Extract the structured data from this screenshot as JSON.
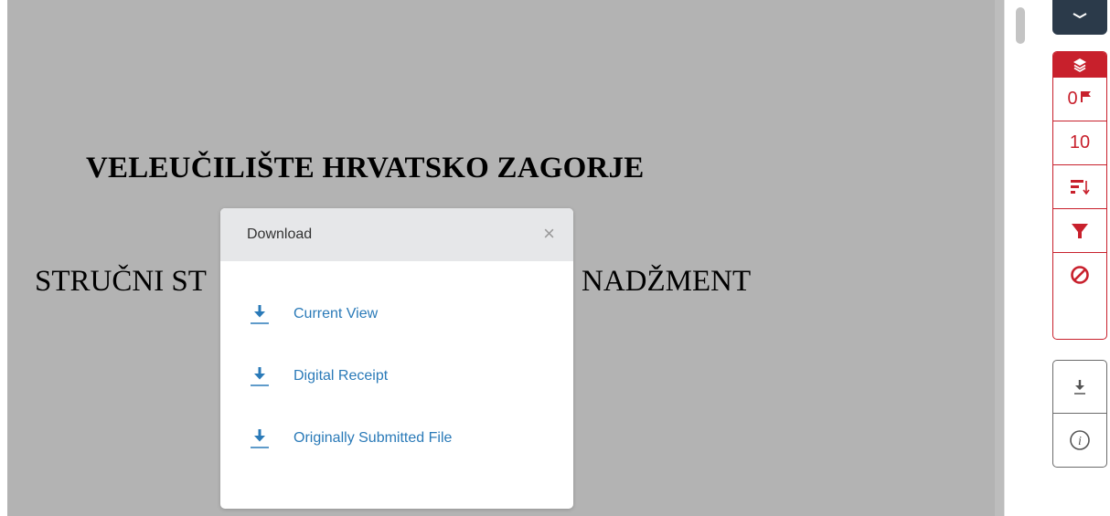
{
  "document": {
    "title": "VELEUČILIŠTE HRVATSKO ZAGORJE",
    "subtitle_left": "STRUČNI ST",
    "subtitle_right": "NADŽMENT"
  },
  "modal": {
    "title": "Download",
    "close_label": "×",
    "items": [
      {
        "label": "Current View",
        "icon": "download-icon"
      },
      {
        "label": "Digital Receipt",
        "icon": "download-icon"
      },
      {
        "label": "Originally Submitted File",
        "icon": "download-icon"
      }
    ]
  },
  "rail": {
    "top_icon": "layers-icon",
    "group_icon": "layers-icon",
    "flags_count": "0",
    "match_count": "10",
    "sort_icon": "sort-icon",
    "filter_icon": "filter-icon",
    "exclude_icon": "ban-icon",
    "download_icon": "download-icon",
    "info_icon": "info-icon"
  },
  "colors": {
    "accent_red": "#c8202c",
    "link_blue": "#2a7ab8",
    "doc_background": "#b3b3b3",
    "top_button": "#2b3a4a"
  }
}
